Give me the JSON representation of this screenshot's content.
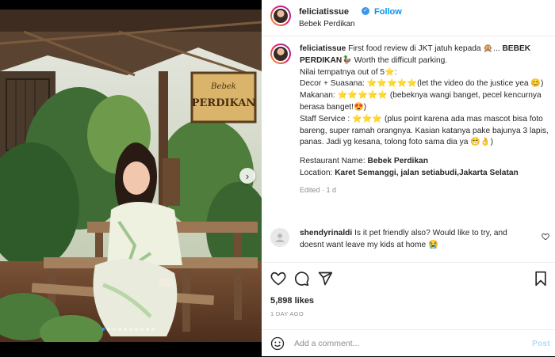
{
  "post": {
    "username": "feliciatissue",
    "follow_label": "Follow",
    "location": "Bebek Perdikan",
    "sign_text": [
      "Bebek",
      "PERDIKAN"
    ],
    "carousel": {
      "total": 10,
      "active": 1
    }
  },
  "caption": {
    "username": "feliciatissue",
    "line1": "First food review di JKT jatuh kepada 🙊... ",
    "line1_bold": "BEBEK PERDIKAN",
    "line1_end": "🦆 Worth the difficult parking.",
    "line2": "Nilai tempatnya out of 5⭐️:",
    "line3": "Decor + Suasana: ⭐️⭐️⭐️⭐️⭐️(let the video do the justice yea 😊)",
    "line4": "Makanan: ⭐️⭐️⭐️⭐️⭐️ (bebeknya wangi banget, pecel kencurnya berasa banget!😍)",
    "line5": "Staff Service : ⭐️⭐️⭐️ (plus point karena ada mas mascot bisa foto bareng, super ramah orangnya. Kasian katanya pake bajunya 3 lapis, panas. Jadi yg kesana, tolong foto sama dia ya 😁👌)",
    "rest_label": "Restaurant Name: ",
    "rest_name": "Bebek Perdikan",
    "loc_label": "Location: ",
    "loc_value": "Karet Semanggi, jalan setiabudi,Jakarta Selatan",
    "meta": "Edited · 1 d"
  },
  "comment": {
    "username": "shendyrinaldi",
    "text": " Is it pet friendly also? Would like to try, and doesnt want leave my kids at home 😭"
  },
  "stats": {
    "likes": "5,898 likes",
    "date": "1 DAY AGO"
  },
  "add_comment": {
    "placeholder": "Add a comment...",
    "post_label": "Post"
  },
  "icons": {
    "verified": "verified-badge-icon",
    "like": "heart-icon",
    "comment": "comment-icon",
    "share": "send-icon",
    "save": "bookmark-icon",
    "emoji": "smiley-icon",
    "next": "chevron-right-icon"
  },
  "colors": {
    "accent": "#0095f6",
    "carousel_active": "#2196f3"
  }
}
